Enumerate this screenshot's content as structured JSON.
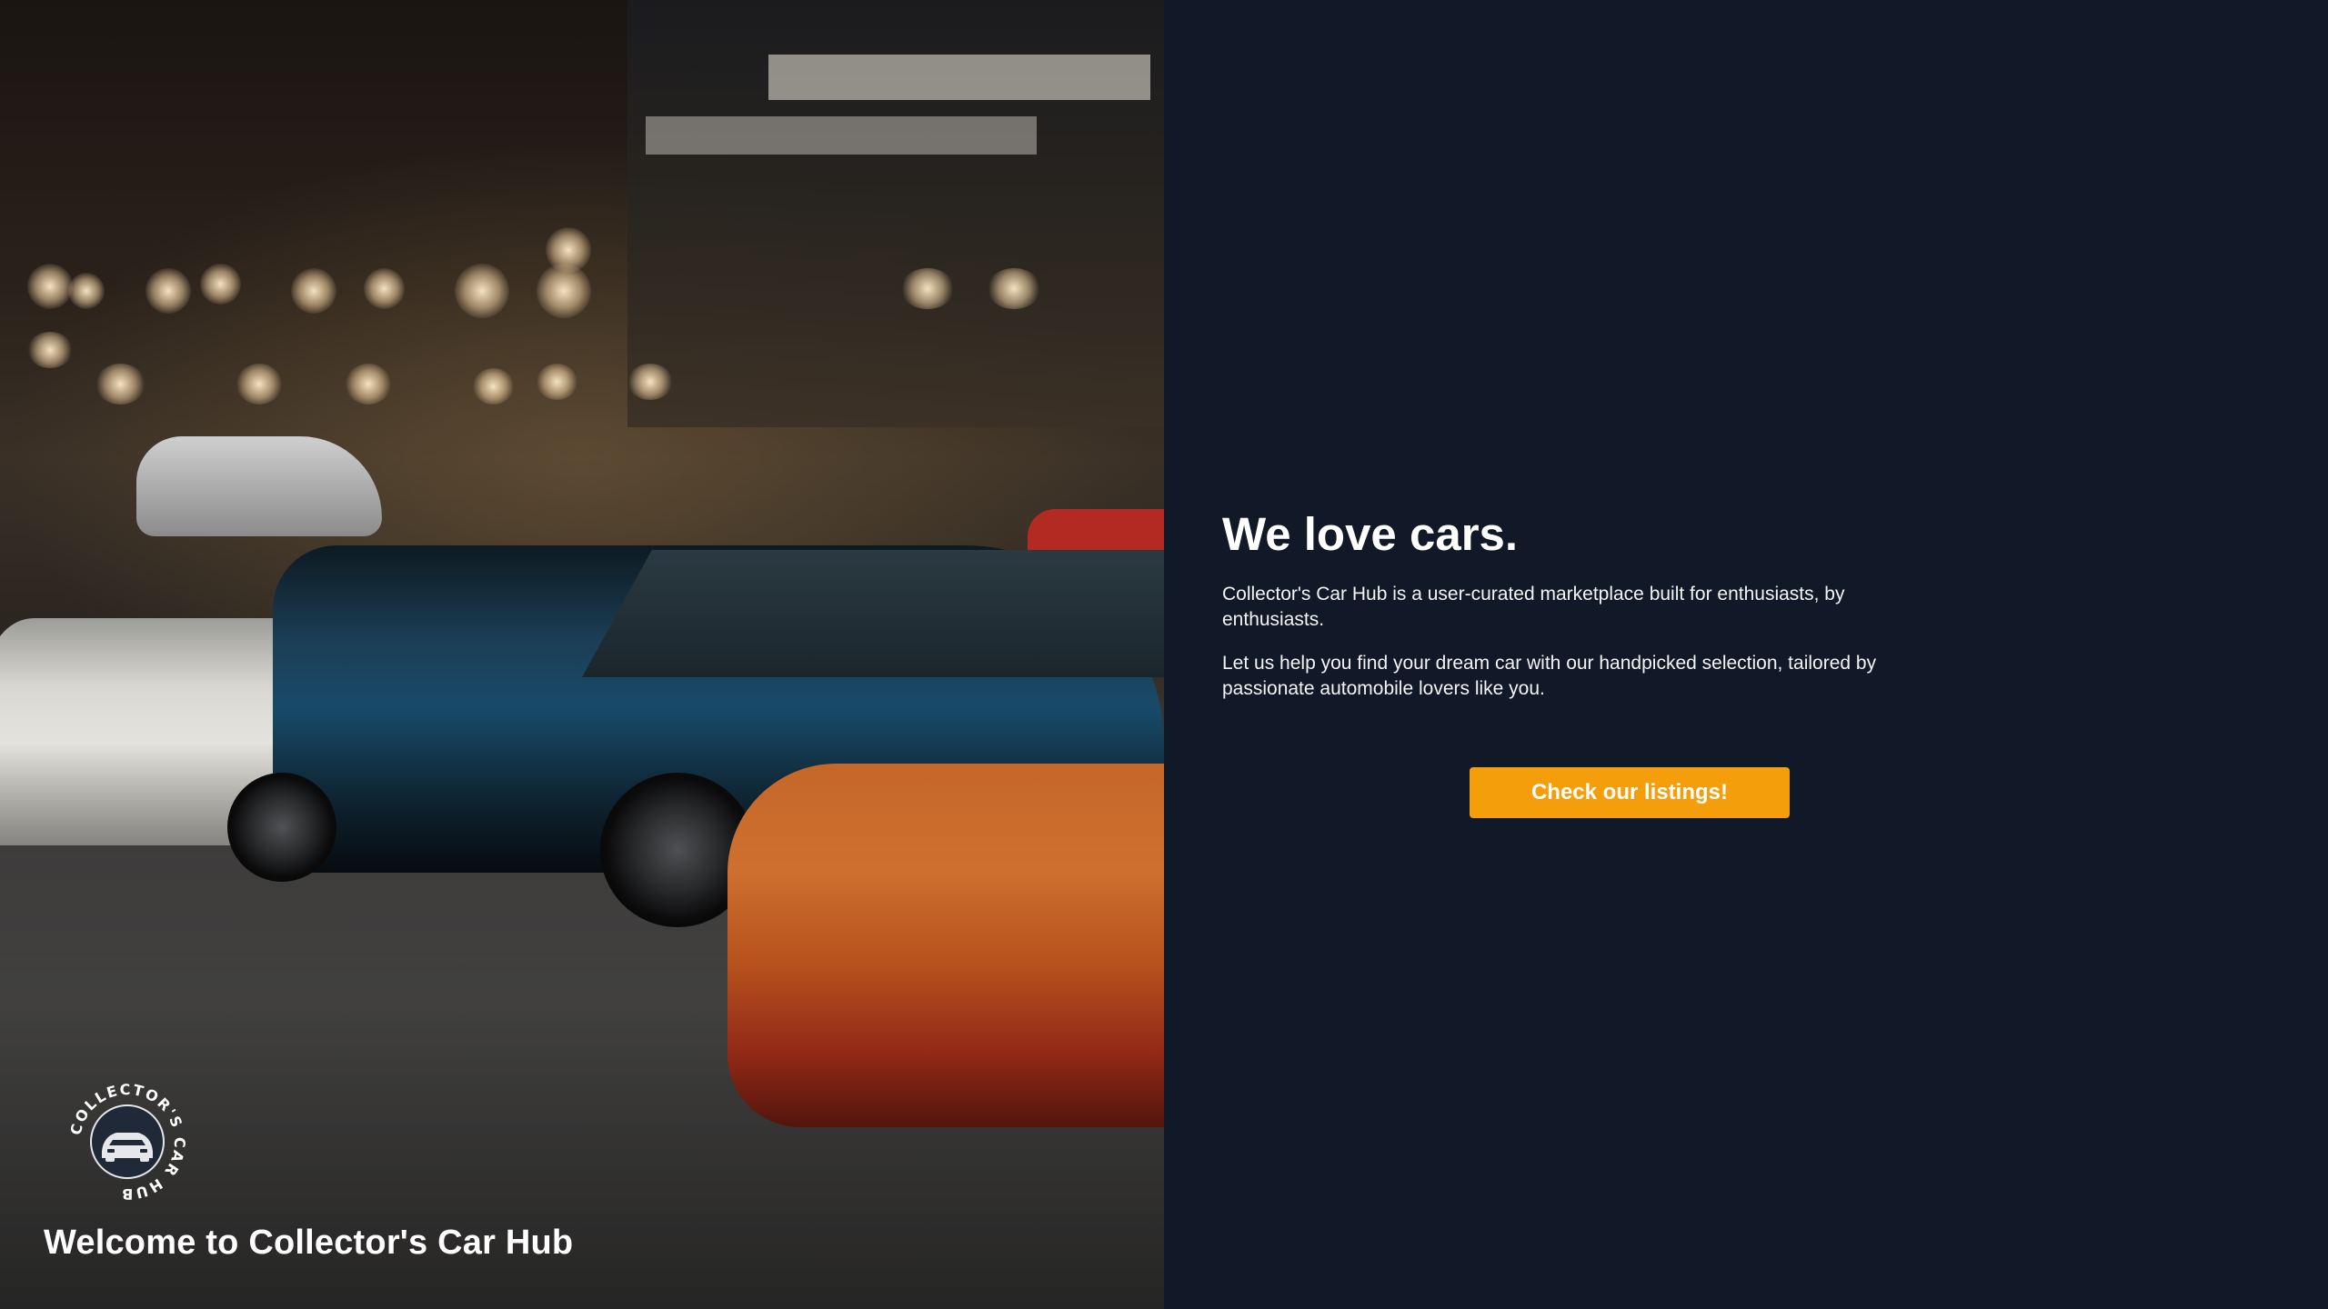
{
  "hero": {
    "title": "Welcome to Collector's Car Hub",
    "logo": {
      "icon": "collectors-car-hub-logo",
      "ring_text": "COLLECTOR'S CAR HUB"
    }
  },
  "content": {
    "heading": "We love cars.",
    "paragraphs": [
      "Collector's Car Hub is a user-curated marketplace built for enthusiasts, by enthusiasts.",
      "Let us help you find your dream car with our handpicked selection, tailored by passionate automobile lovers like you."
    ],
    "cta_label": "Check our listings!"
  },
  "colors": {
    "background": "#111827",
    "accent": "#f59e0b",
    "text": "#ffffff"
  }
}
